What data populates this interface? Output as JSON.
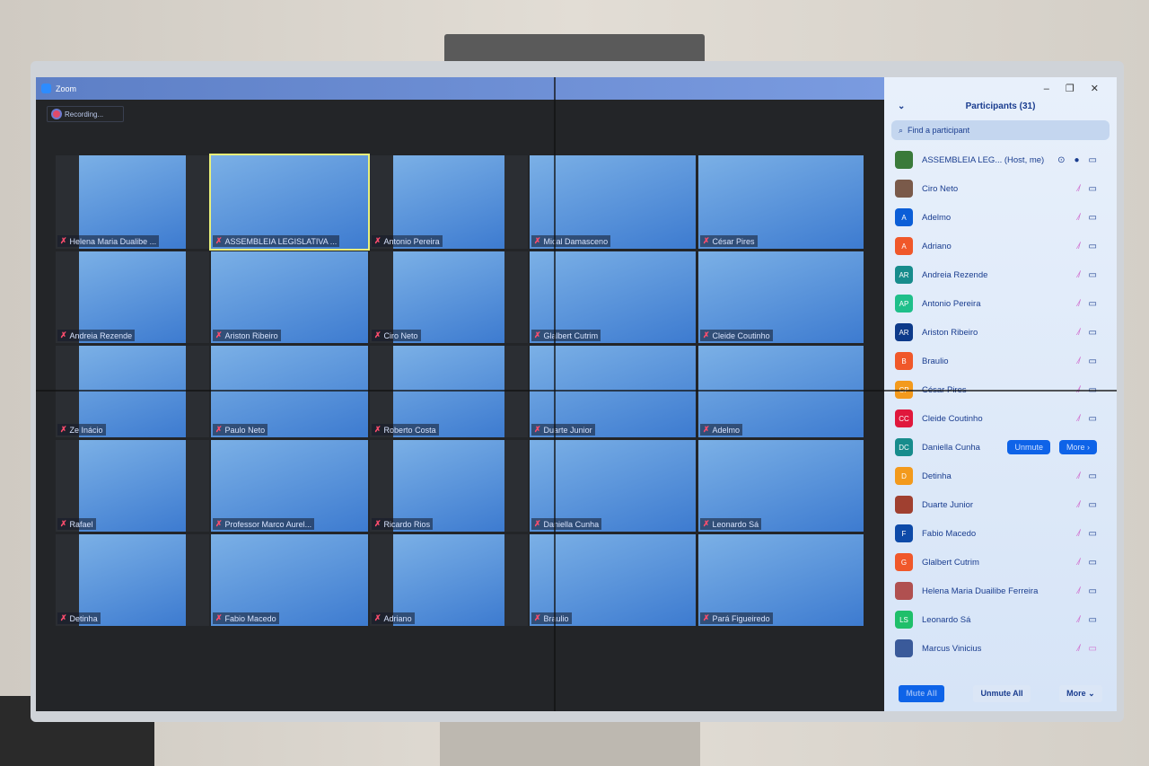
{
  "window": {
    "title": "Zoom",
    "recording": "Recording..."
  },
  "grid": [
    "Helena Maria Dualibe ...",
    "ASSEMBLEIA LEGISLATIVA ...",
    "Antonio Pereira",
    "Mical Damasceno",
    "César Pires",
    "Andreia Rezende",
    "Ariston Ribeiro",
    "Ciro Neto",
    "Glalbert Cutrim",
    "Cleide Coutinho",
    "Ze Inácio",
    "Paulo Neto",
    "Roberto Costa",
    "Duarte Junior",
    "Adelmo",
    "Rafael",
    "Professor Marco Aurel...",
    "Ricardo Rios",
    "Daniella Cunha",
    "Leonardo Sá",
    "Detinha",
    "Fabio Macedo",
    "Adriano",
    "Braulio",
    "Pará Figueiredo"
  ],
  "active_speaker": "ASSEMBLEIA LEGISLATIVA ...",
  "panel": {
    "title": "Participants (31)",
    "search_placeholder": "Find a participant",
    "participants": [
      {
        "name": "ASSEMBLEIA LEG... (Host, me)",
        "initials": "",
        "color": "#3a7a3a",
        "muted": false
      },
      {
        "name": "Ciro Neto",
        "initials": "",
        "color": "#7a5a4a",
        "muted": true
      },
      {
        "name": "Adelmo",
        "initials": "A",
        "color": "#0b5ed7",
        "muted": true
      },
      {
        "name": "Adriano",
        "initials": "A",
        "color": "#f0582a",
        "muted": true
      },
      {
        "name": "Andreia Rezende",
        "initials": "AR",
        "color": "#178c8c",
        "muted": true
      },
      {
        "name": "Antonio Pereira",
        "initials": "AP",
        "color": "#1fbf8a",
        "muted": true
      },
      {
        "name": "Ariston Ribeiro",
        "initials": "AR",
        "color": "#0d3a8a",
        "muted": true
      },
      {
        "name": "Braulio",
        "initials": "B",
        "color": "#f0582a",
        "muted": true
      },
      {
        "name": "César Pires",
        "initials": "CP",
        "color": "#f39a1c",
        "muted": true
      },
      {
        "name": "Cleide Coutinho",
        "initials": "CC",
        "color": "#e0183c",
        "muted": true
      },
      {
        "name": "Daniella Cunha",
        "initials": "DC",
        "color": "#178c8c",
        "muted": true,
        "hover": true
      },
      {
        "name": "Detinha",
        "initials": "D",
        "color": "#f39a1c",
        "muted": true
      },
      {
        "name": "Duarte Junior",
        "initials": "",
        "color": "#a04030",
        "muted": true
      },
      {
        "name": "Fabio Macedo",
        "initials": "F",
        "color": "#0d4aa8",
        "muted": true
      },
      {
        "name": "Glalbert Cutrim",
        "initials": "G",
        "color": "#f0582a",
        "muted": true
      },
      {
        "name": "Helena Maria Duailibe Ferreira",
        "initials": "",
        "color": "#b05050",
        "muted": true
      },
      {
        "name": "Leonardo Sá",
        "initials": "LS",
        "color": "#1fbf6a",
        "muted": true
      },
      {
        "name": "Marcus Vinicius",
        "initials": "",
        "color": "#3a5a9a",
        "muted": true,
        "video_off": true
      }
    ],
    "hover_unmute": "Unmute",
    "hover_more": "More ›",
    "mute_all": "Mute All",
    "unmute_all": "Unmute All",
    "more": "More ⌄"
  }
}
